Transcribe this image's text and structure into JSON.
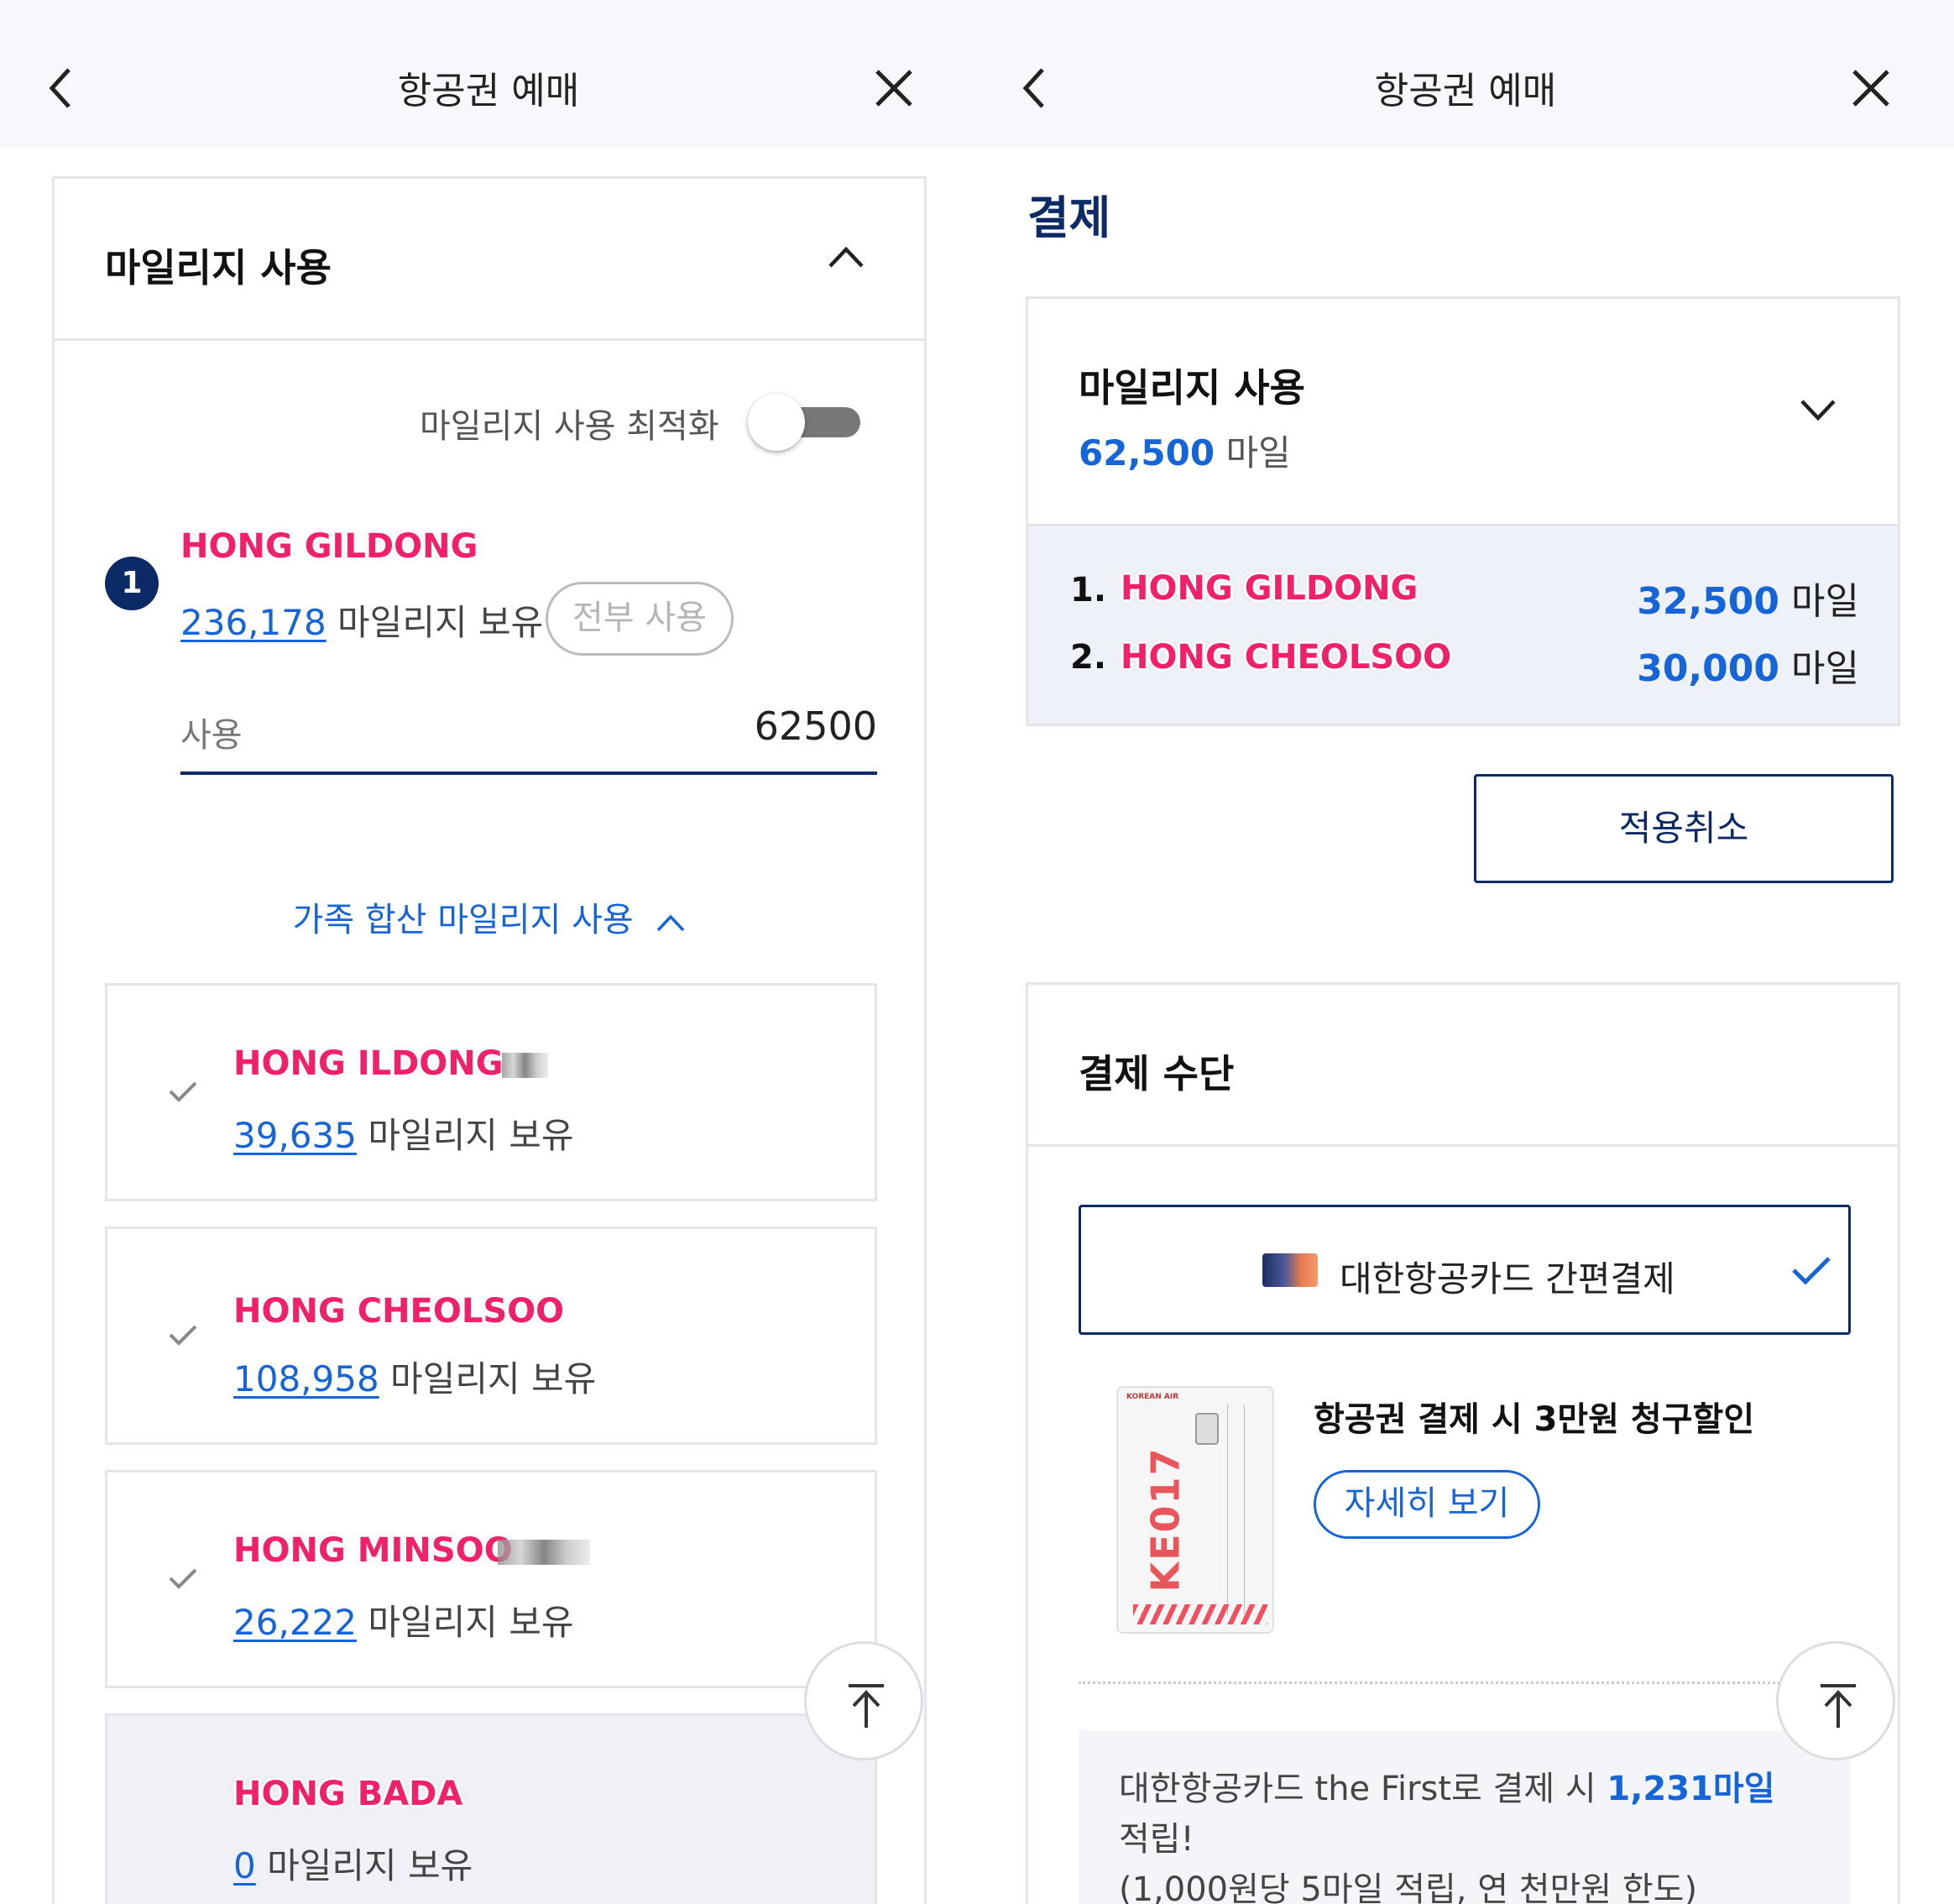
{
  "left": {
    "header_title": "항공권 예매",
    "section_title": "마일리지 사용",
    "optimize_label": "마일리지 사용 최적화",
    "main_member": {
      "index": "1",
      "name": "HONG GILDONG",
      "balance": "236,178",
      "balance_suffix": "마일리지 보유",
      "use_all_label": "전부 사용",
      "use_label": "사용",
      "use_value": "62500"
    },
    "family_toggle_label": "가족 합산 마일리지 사용",
    "family": [
      {
        "name": "HONG ILDONG",
        "balance": "39,635",
        "suffix": "마일리지 보유"
      },
      {
        "name": "HONG CHEOLSOO",
        "balance": "108,958",
        "suffix": "마일리지 보유"
      },
      {
        "name": "HONG MINSOO",
        "balance": "26,222",
        "suffix": "마일리지 보유"
      },
      {
        "name": "HONG BADA",
        "balance": "0",
        "suffix": "마일리지 보유"
      }
    ]
  },
  "right": {
    "header_title": "항공권 예매",
    "page_title": "결제",
    "mileage_card": {
      "title": "마일리지 사용",
      "amount": "62,500",
      "unit": "마일",
      "breakdown": [
        {
          "index": "1.",
          "name": "HONG GILDONG",
          "amount": "32,500",
          "unit": "마일"
        },
        {
          "index": "2.",
          "name": "HONG CHEOLSOO",
          "amount": "30,000",
          "unit": "마일"
        }
      ]
    },
    "cancel_button": "적용취소",
    "payment": {
      "title": "결제 수단",
      "method_label": "대한항공카드 간편결제",
      "card_brand": "KOREAN AIR",
      "card_code": "KE017",
      "promo_title": "항공권 결제 시 3만원 청구할인",
      "details_button": "자세히 보기",
      "info_prefix": "대한항공카드 the First로 결제 시 ",
      "info_highlight": "1,231마일",
      "info_line2": "적립!",
      "info_line3": "(1,000원당 5마일 적립, 연 천만원 한도)"
    }
  }
}
